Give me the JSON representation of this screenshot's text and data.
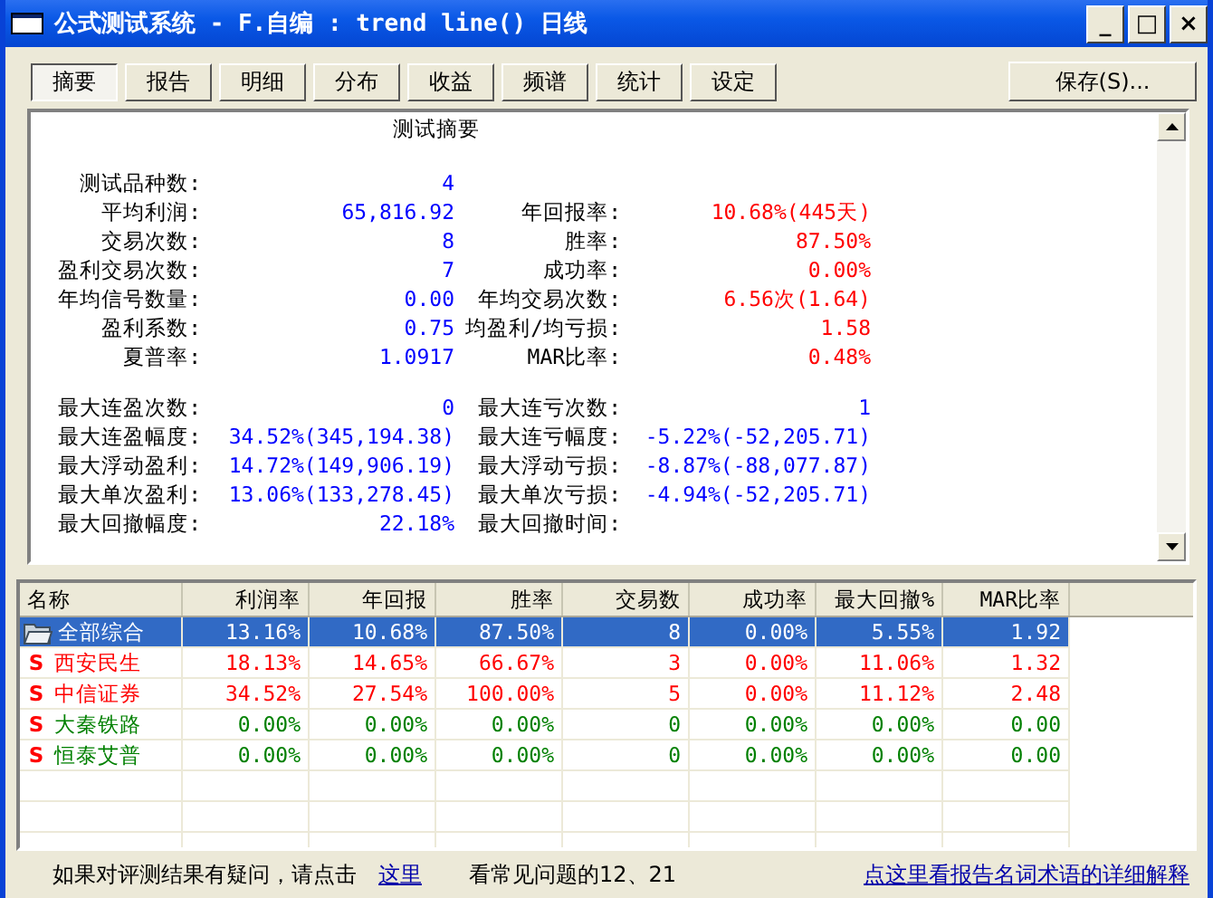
{
  "window": {
    "title": "公式测试系统 - F.自编 : trend line() 日线",
    "controls": [
      "_",
      "□",
      "×"
    ]
  },
  "tabs": [
    {
      "label": "摘要",
      "selected": true
    },
    {
      "label": "报告",
      "selected": false
    },
    {
      "label": "明细",
      "selected": false
    },
    {
      "label": "分布",
      "selected": false
    },
    {
      "label": "收益",
      "selected": false
    },
    {
      "label": "频谱",
      "selected": false
    },
    {
      "label": "统计",
      "selected": false
    },
    {
      "label": "设定",
      "selected": false
    }
  ],
  "save_button": "保存(S)...",
  "summary": {
    "title": "测试摘要",
    "blocks": [
      [
        {
          "left": {
            "label": "测试品种数:",
            "value": "4",
            "color": "#0000ff"
          }
        },
        {
          "left": {
            "label": "平均利润:",
            "value": "65,816.92",
            "color": "#0000ff"
          },
          "right": {
            "label": "年回报率:",
            "value": "10.68%(445天)",
            "color": "#ff0000"
          }
        },
        {
          "left": {
            "label": "交易次数:",
            "value": "8",
            "color": "#0000ff"
          },
          "right": {
            "label": "胜率:",
            "value": "87.50%",
            "color": "#ff0000"
          }
        },
        {
          "left": {
            "label": "盈利交易次数:",
            "value": "7",
            "color": "#0000ff"
          },
          "right": {
            "label": "成功率:",
            "value": "0.00%",
            "color": "#ff0000"
          }
        },
        {
          "left": {
            "label": "年均信号数量:",
            "value": "0.00",
            "color": "#0000ff"
          },
          "right": {
            "label": "年均交易次数:",
            "value": "6.56次(1.64)",
            "color": "#ff0000"
          }
        },
        {
          "left": {
            "label": "盈利系数:",
            "value": "0.75",
            "color": "#0000ff"
          },
          "right": {
            "label": "均盈利/均亏损:",
            "value": "1.58",
            "color": "#ff0000"
          }
        },
        {
          "left": {
            "label": "夏普率:",
            "value": "1.0917",
            "color": "#0000ff"
          },
          "right": {
            "label": "MAR比率:",
            "value": "0.48%",
            "color": "#ff0000"
          }
        }
      ],
      [
        {
          "left": {
            "label": "最大连盈次数:",
            "value": "0",
            "color": "#0000ff"
          },
          "right": {
            "label": "最大连亏次数:",
            "value": "1",
            "color": "#0000ff"
          }
        },
        {
          "left": {
            "label": "最大连盈幅度:",
            "value": "34.52%(345,194.38)",
            "color": "#0000ff"
          },
          "right": {
            "label": "最大连亏幅度:",
            "value": "-5.22%(-52,205.71)",
            "color": "#0000ff"
          }
        },
        {
          "left": {
            "label": "最大浮动盈利:",
            "value": "14.72%(149,906.19)",
            "color": "#0000ff"
          },
          "right": {
            "label": "最大浮动亏损:",
            "value": "-8.87%(-88,077.87)",
            "color": "#0000ff"
          }
        },
        {
          "left": {
            "label": "最大单次盈利:",
            "value": "13.06%(133,278.45)",
            "color": "#0000ff"
          },
          "right": {
            "label": "最大单次亏损:",
            "value": "-4.94%(-52,205.71)",
            "color": "#0000ff"
          }
        },
        {
          "left": {
            "label": "最大回撤幅度:",
            "value": "22.18%",
            "color": "#0000ff"
          },
          "right": {
            "label": "最大回撤时间:"
          }
        }
      ]
    ]
  },
  "table": {
    "columns": [
      "名称",
      "利润率",
      "年回报",
      "胜率",
      "交易数",
      "成功率",
      "最大回撤%",
      "MAR比率"
    ],
    "rows": [
      {
        "kind": "folder",
        "selected": true,
        "color": "#ffffff",
        "cells": [
          "全部综合",
          "13.16%",
          "10.68%",
          "87.50%",
          "8",
          "0.00%",
          "5.55%",
          "1.92"
        ]
      },
      {
        "kind": "stock",
        "marker": "S",
        "selected": false,
        "color": "#ff0000",
        "cells": [
          "西安民生",
          "18.13%",
          "14.65%",
          "66.67%",
          "3",
          "0.00%",
          "11.06%",
          "1.32"
        ]
      },
      {
        "kind": "stock",
        "marker": "S",
        "selected": false,
        "color": "#ff0000",
        "cells": [
          "中信证券",
          "34.52%",
          "27.54%",
          "100.00%",
          "5",
          "0.00%",
          "11.12%",
          "2.48"
        ]
      },
      {
        "kind": "stock",
        "marker": "S",
        "selected": false,
        "color": "#008000",
        "cells": [
          "大秦铁路",
          "0.00%",
          "0.00%",
          "0.00%",
          "0",
          "0.00%",
          "0.00%",
          "0.00"
        ]
      },
      {
        "kind": "stock",
        "marker": "S",
        "selected": false,
        "color": "#008000",
        "cells": [
          "恒泰艾普",
          "0.00%",
          "0.00%",
          "0.00%",
          "0",
          "0.00%",
          "0.00%",
          "0.00"
        ]
      }
    ]
  },
  "footer": {
    "text": "如果对评测结果有疑问，请点击",
    "link": "这里",
    "text_2": "看常见问题的12、21",
    "help_link": "点这里看报告名词术语的详细解释"
  }
}
